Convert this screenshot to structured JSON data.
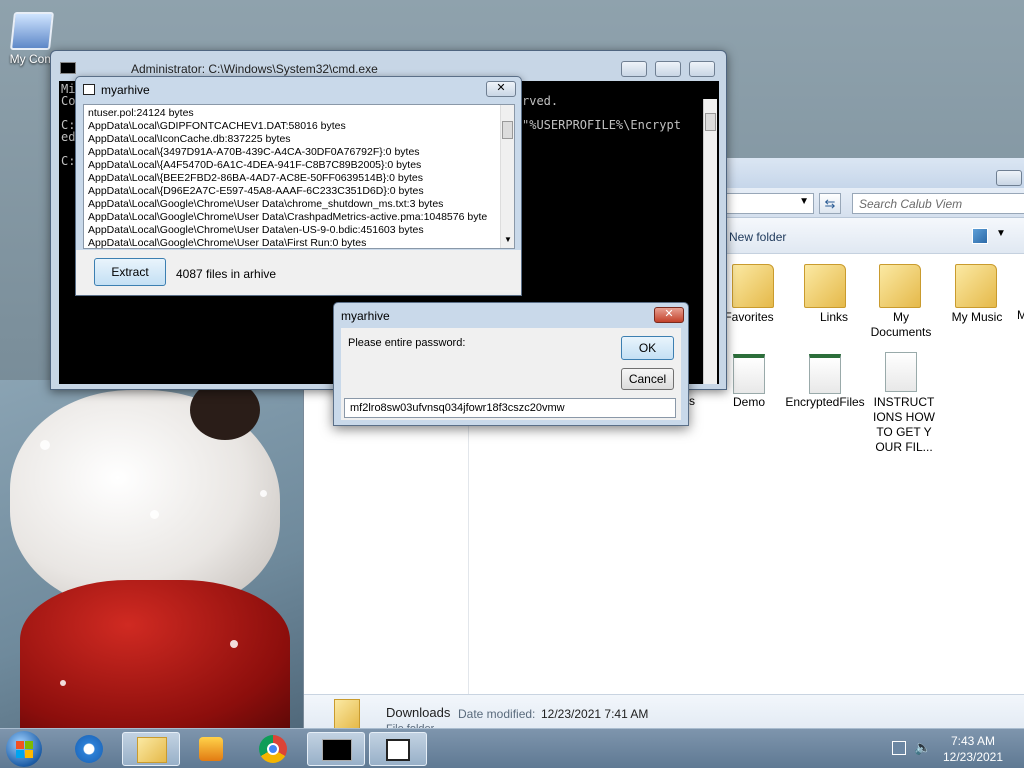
{
  "desktop": {
    "icon_label": "My Com"
  },
  "cmd_window": {
    "title": "Administrator: C:\\Windows\\System32\\cmd.exe",
    "lines_left": [
      "Mi",
      "Co",
      "",
      "C:",
      "ed",
      "",
      "C:"
    ],
    "lines_right": [
      "rved.",
      "",
      "",
      "\"%USERPROFILE%\\Encrypt"
    ]
  },
  "archive_window": {
    "title": "myarhive",
    "files": [
      "ntuser.pol:24124 bytes",
      "AppData\\Local\\GDIPFONTCACHEV1.DAT:58016 bytes",
      "AppData\\Local\\IconCache.db:837225 bytes",
      "AppData\\Local\\{3497D91A-A70B-439C-A4CA-30DF0A76792F}:0 bytes",
      "AppData\\Local\\{A4F5470D-6A1C-4DEA-941F-C8B7C89B2005}:0 bytes",
      "AppData\\Local\\{BEE2FBD2-86BA-4AD7-AC8E-50FF0639514B}:0 bytes",
      "AppData\\Local\\{D96E2A7C-E597-45A8-AAAF-6C233C351D6D}:0 bytes",
      "AppData\\Local\\Google\\Chrome\\User Data\\chrome_shutdown_ms.txt:3 bytes",
      "AppData\\Local\\Google\\Chrome\\User Data\\CrashpadMetrics-active.pma:1048576 byte",
      "AppData\\Local\\Google\\Chrome\\User Data\\en-US-9-0.bdic:451603 bytes",
      "AppData\\Local\\Google\\Chrome\\User Data\\First Run:0 bytes"
    ],
    "extract_label": "Extract",
    "file_count": "4087 files in arhive"
  },
  "password_dialog": {
    "title": "myarhive",
    "prompt": "Please entire password:",
    "ok_label": "OK",
    "cancel_label": "Cancel",
    "password_value": "mf2lro8sw03ufvnsq034jfowr18f3cszc20vmw"
  },
  "explorer": {
    "search_placeholder": "Search Calub Viem",
    "new_folder_label": "New folder",
    "items": [
      {
        "label": "Favorites",
        "kind": "folder"
      },
      {
        "label": "Links",
        "kind": "folder"
      },
      {
        "label": "My Documents",
        "kind": "folder"
      },
      {
        "label": "My Music",
        "kind": "folder"
      },
      {
        "label": "M",
        "kind": "folder"
      },
      {
        "label": "s",
        "kind": "partial"
      },
      {
        "label": "Demo",
        "kind": "file"
      },
      {
        "label": "EncryptedFiles",
        "kind": "file"
      },
      {
        "label": "INSTRUCTIONS HOW TO GET YOUR FIL...",
        "kind": "document"
      }
    ],
    "details": {
      "name": "Downloads",
      "modified_label": "Date modified:",
      "modified_value": "12/23/2021 7:41 AM",
      "sub": "File folder"
    }
  },
  "taskbar": {
    "time": "7:43 AM",
    "date": "12/23/2021",
    "apps": [
      "start",
      "internet-explorer",
      "windows-explorer",
      "media-player",
      "chrome",
      "cmd",
      "myarhive"
    ]
  }
}
